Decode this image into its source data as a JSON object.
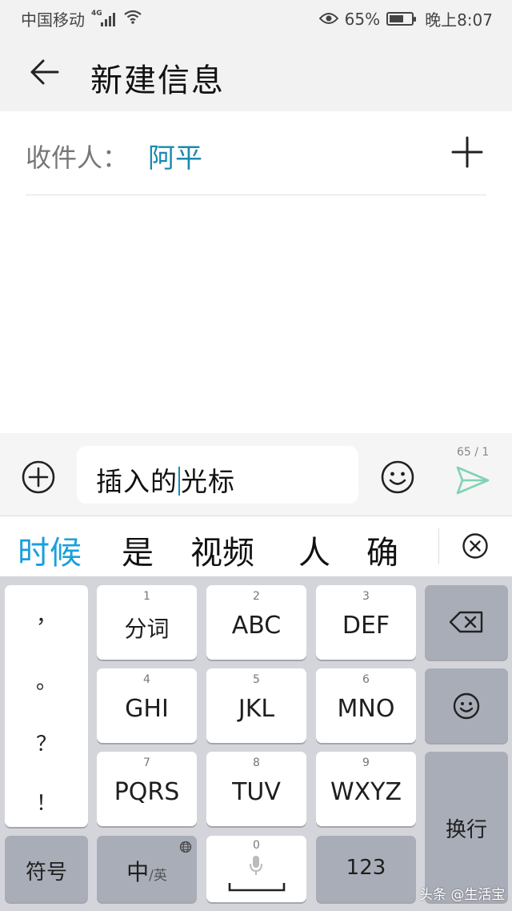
{
  "status_bar": {
    "carrier": "中国移动",
    "network": "4G",
    "battery_percent": "65%",
    "battery_level": 0.65,
    "time": "晚上8:07"
  },
  "header": {
    "title": "新建信息",
    "back_icon": "arrow-left-icon"
  },
  "recipient": {
    "label": "收件人：",
    "name": "阿平",
    "add_icon": "plus-icon"
  },
  "compose": {
    "text_before_caret": "插入的",
    "text_after_caret": "光标",
    "char_count": "65 / 1",
    "attach_icon": "circle-plus-icon",
    "emoji_icon": "smiley-icon",
    "send_icon": "paper-plane-icon"
  },
  "candidates": {
    "items": [
      "时候",
      "是",
      "视频",
      "人",
      "确"
    ],
    "close_icon": "circle-x-icon"
  },
  "keyboard": {
    "punctuation": [
      "，",
      "。",
      "？",
      "！"
    ],
    "keys": [
      {
        "num": "1",
        "label": "分词"
      },
      {
        "num": "2",
        "label": "ABC"
      },
      {
        "num": "3",
        "label": "DEF"
      },
      {
        "num": "4",
        "label": "GHI"
      },
      {
        "num": "5",
        "label": "JKL"
      },
      {
        "num": "6",
        "label": "MNO"
      },
      {
        "num": "7",
        "label": "PQRS"
      },
      {
        "num": "8",
        "label": "TUV"
      },
      {
        "num": "9",
        "label": "WXYZ"
      }
    ],
    "symbols_label": "符号",
    "lang_main": "中",
    "lang_alt": "/英",
    "space_num": "0",
    "numbers_label": "123",
    "enter_label": "换行",
    "backspace_icon": "backspace-icon",
    "emoji_icon": "smiley-icon",
    "mic_icon": "microphone-icon",
    "globe_icon": "globe-icon"
  },
  "watermark": "头条 @生活宝",
  "colors": {
    "accent": "#1a8ab0",
    "candidate_active": "#1aa0dc",
    "send": "#7fd3b3"
  }
}
